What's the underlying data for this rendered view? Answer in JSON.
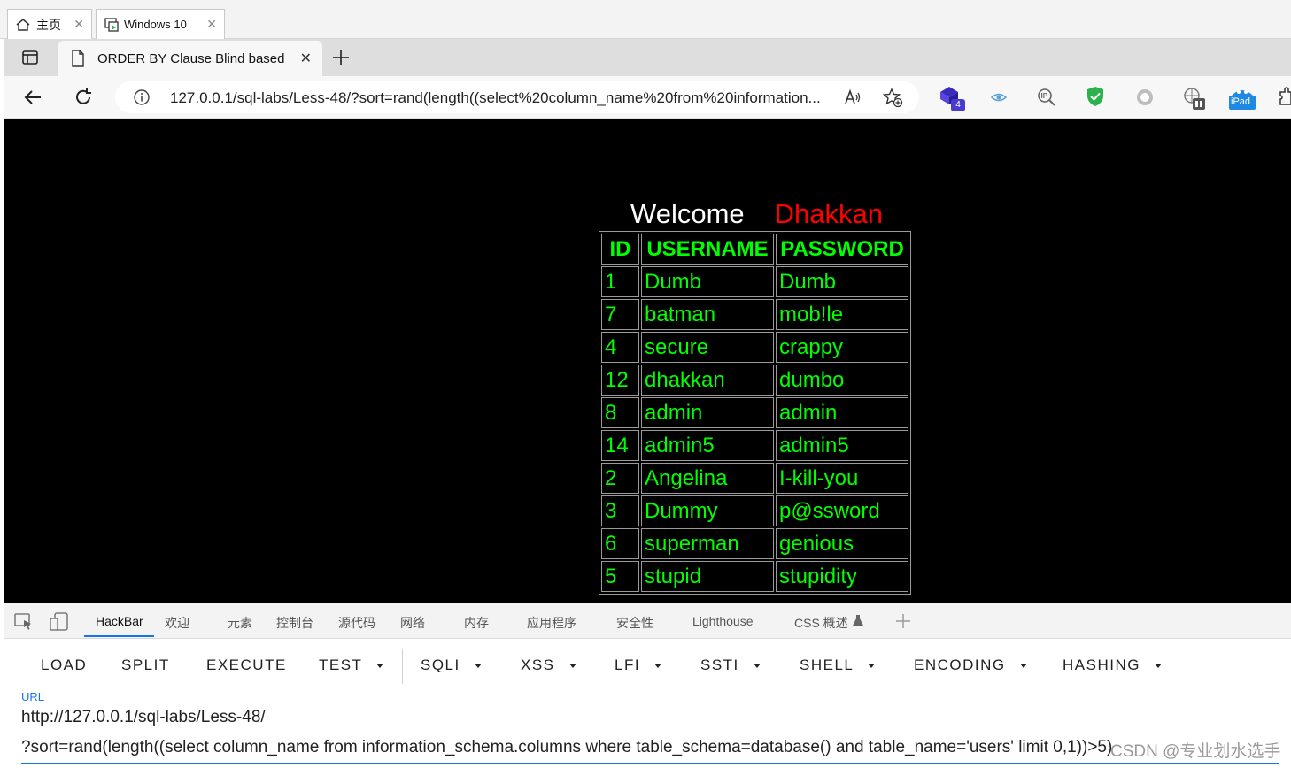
{
  "vm_tabs": [
    {
      "label": "主页"
    },
    {
      "label": "Windows 10"
    }
  ],
  "browser": {
    "tab_title": "ORDER BY Clause Blind based",
    "address": "127.0.0.1/sql-labs/Less-48/?sort=rand(length((select%20column_name%20from%20information...",
    "ext_badge_count": "4",
    "ipad_label": "iPad"
  },
  "page": {
    "welcome": "Welcome",
    "name": "Dhakkan",
    "table": {
      "headers": [
        "ID",
        "USERNAME",
        "PASSWORD"
      ],
      "rows": [
        [
          "1",
          "Dumb",
          "Dumb"
        ],
        [
          "7",
          "batman",
          "mob!le"
        ],
        [
          "4",
          "secure",
          "crappy"
        ],
        [
          "12",
          "dhakkan",
          "dumbo"
        ],
        [
          "8",
          "admin",
          "admin"
        ],
        [
          "14",
          "admin5",
          "admin5"
        ],
        [
          "2",
          "Angelina",
          "I-kill-you"
        ],
        [
          "3",
          "Dummy",
          "p@ssword"
        ],
        [
          "6",
          "superman",
          "genious"
        ],
        [
          "5",
          "stupid",
          "stupidity"
        ]
      ]
    }
  },
  "devtools": {
    "tabs": [
      "HackBar",
      "欢迎",
      "元素",
      "控制台",
      "源代码",
      "网络",
      "内存",
      "应用程序",
      "安全性",
      "Lighthouse",
      "CSS 概述"
    ],
    "hackbar_buttons": [
      "LOAD",
      "SPLIT",
      "EXECUTE",
      "TEST",
      "SQLI",
      "XSS",
      "LFI",
      "SSTI",
      "SHELL",
      "ENCODING",
      "HASHING"
    ],
    "url_label": "URL",
    "url_line1": "http://127.0.0.1/sql-labs/Less-48/",
    "url_line2": "?sort=rand(length((select column_name from information_schema.columns where table_schema=database() and table_name='users' limit 0,1))>5)",
    "watermark": "CSDN @专业划水选手"
  },
  "colors": {
    "accent": "#1a73e8",
    "table_text": "#00ff00",
    "name_red": "#ff0000",
    "page_bg": "#000000",
    "shield_green": "#2bb24c"
  }
}
